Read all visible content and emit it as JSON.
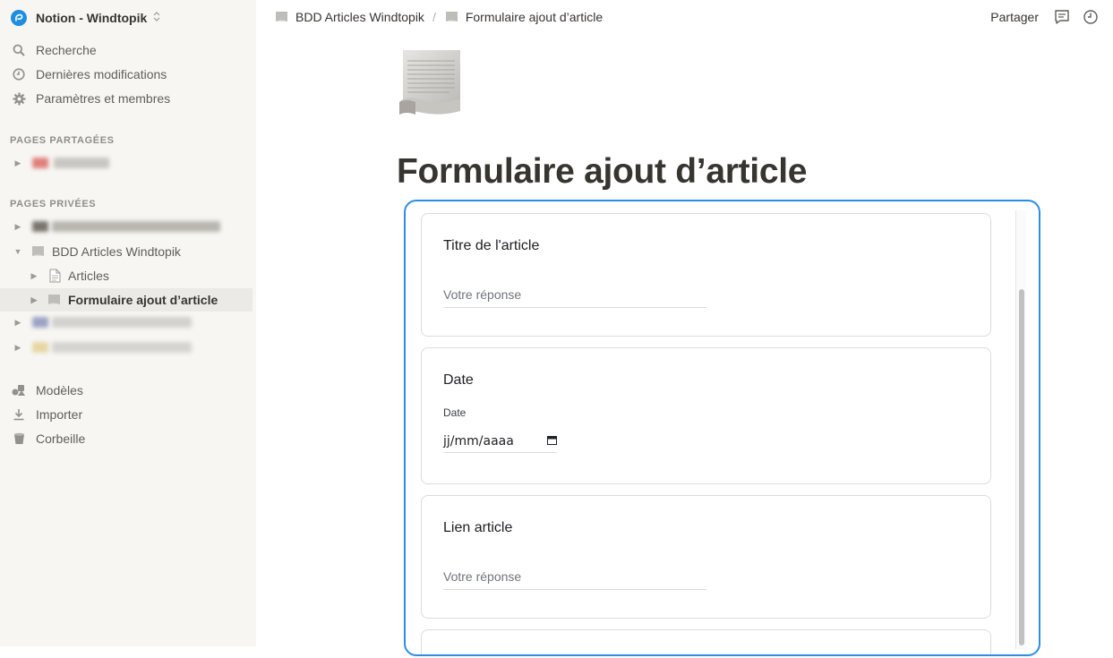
{
  "workspace": {
    "name": "Notion - Windtopik",
    "chevron": "⌃"
  },
  "nav": [
    {
      "label": "Recherche",
      "icon": "search-icon"
    },
    {
      "label": "Dernières modifications",
      "icon": "clock-icon"
    },
    {
      "label": "Paramètres et membres",
      "icon": "gear-icon"
    }
  ],
  "sections": {
    "shared": "PAGES PARTAGÉES",
    "private": "PAGES PRIVÉES"
  },
  "tree": {
    "bdd_label": "BDD Articles Windtopik",
    "articles_label": "Articles",
    "form_label": "Formulaire ajout d’article"
  },
  "bottom_nav": [
    {
      "label": "Modèles",
      "icon": "templates-icon"
    },
    {
      "label": "Importer",
      "icon": "import-icon"
    },
    {
      "label": "Corbeille",
      "icon": "trash-icon"
    }
  ],
  "breadcrumb": {
    "parent": "BDD Articles Windtopik",
    "separator": "/",
    "current": "Formulaire ajout d’article"
  },
  "topbar": {
    "share": "Partager"
  },
  "page": {
    "title": "Formulaire ajout d’article"
  },
  "form": {
    "q1": {
      "question": "Titre de l'article",
      "placeholder": "Votre réponse"
    },
    "q2": {
      "question": "Date",
      "sublabel": "Date",
      "value": "jj/mm/aaaa"
    },
    "q3": {
      "question": "Lien article",
      "placeholder": "Votre réponse"
    }
  },
  "colors": {
    "accent": "#2d8de6",
    "sidebar_bg": "#f7f6f3",
    "active_row": "#ebeae6"
  }
}
